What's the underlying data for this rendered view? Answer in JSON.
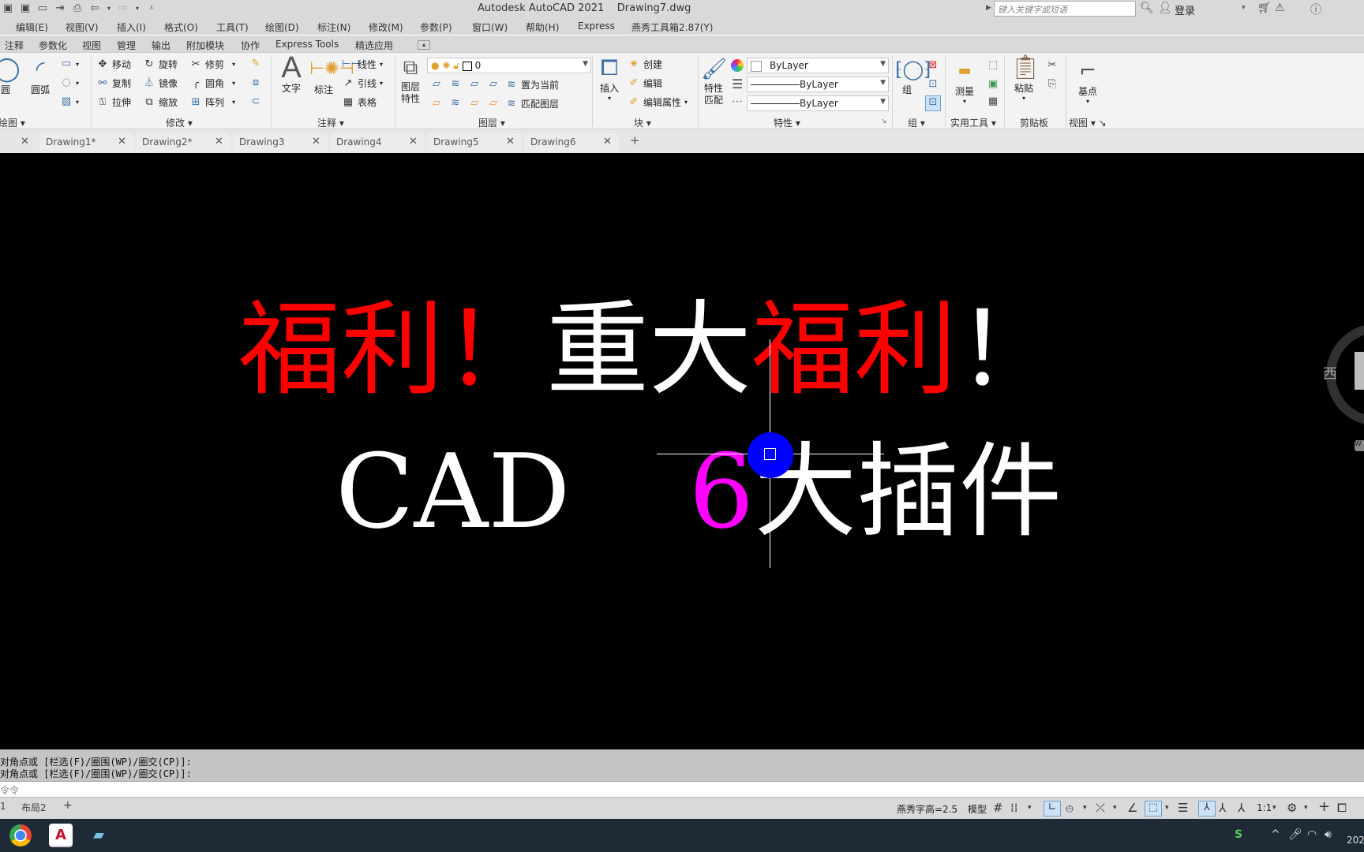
{
  "titlebar": {
    "title": "Autodesk AutoCAD 2021    Drawing7.dwg",
    "quick_access": [
      {
        "name": "save-icon",
        "glyph": "🖫"
      },
      {
        "name": "save-as-icon",
        "glyph": "🖫"
      },
      {
        "name": "open-icon",
        "glyph": "🗋"
      },
      {
        "name": "import-icon",
        "glyph": "⇥"
      },
      {
        "name": "print-icon",
        "glyph": "⎙"
      },
      {
        "name": "undo-icon",
        "glyph": "⇦"
      },
      {
        "name": "redo-icon",
        "glyph": "⇨"
      },
      {
        "name": "customize-icon",
        "glyph": "▾"
      }
    ],
    "search_placeholder": "键入关键字或短语",
    "login_label": "登录"
  },
  "menubar": [
    "编辑(E)",
    "视图(V)",
    "插入(I)",
    "格式(O)",
    "工具(T)",
    "绘图(D)",
    "标注(N)",
    "修改(M)",
    "参数(P)",
    "窗口(W)",
    "帮助(H)",
    "Express",
    "燕秀工具箱2.87(Y)"
  ],
  "ribbon_tabs": [
    "注释",
    "参数化",
    "视图",
    "管理",
    "输出",
    "附加模块",
    "协作",
    "Express Tools",
    "精选应用"
  ],
  "ribbon": {
    "draw": {
      "label": "绘图",
      "circle": "圆",
      "arc": "圆弧"
    },
    "modify": {
      "label": "修改",
      "items": [
        "移动",
        "旋转",
        "修剪",
        "复制",
        "镜像",
        "圆角",
        "拉伸",
        "缩放",
        "阵列"
      ]
    },
    "annotation": {
      "label": "注释",
      "text": "文字",
      "dimension": "标注",
      "linear": "线性",
      "leader": "引线",
      "table": "表格"
    },
    "layers": {
      "label": "图层",
      "properties": "图层特性",
      "current_layer": "0",
      "set_current": "置为当前",
      "match_layer": "匹配图层"
    },
    "block": {
      "label": "块",
      "insert": "插入",
      "create": "创建",
      "edit": "编辑",
      "edit_attr": "编辑属性"
    },
    "properties": {
      "label": "特性",
      "match": "特性匹配",
      "color": "ByLayer",
      "linetype": "ByLayer",
      "lineweight": "ByLayer"
    },
    "groups": {
      "label": "组",
      "group": "组"
    },
    "utilities": {
      "label": "实用工具",
      "measure": "测量"
    },
    "clipboard": {
      "label": "剪贴板",
      "paste": "粘贴"
    },
    "view": {
      "label": "视图",
      "base": "基点"
    }
  },
  "doc_tabs": [
    "Drawing1*",
    "Drawing2*",
    "Drawing3",
    "Drawing4",
    "Drawing5",
    "Drawing6"
  ],
  "canvas": {
    "line1": [
      {
        "text": "福利！",
        "color": "#ff0000"
      },
      {
        "text": "重大",
        "color": "#ffffff"
      },
      {
        "text": "福利",
        "color": "#ff0000"
      },
      {
        "text": "！",
        "color": "#ffffff"
      }
    ],
    "line2": [
      {
        "text": "CAD",
        "color": "#ffffff"
      },
      {
        "text": "6",
        "color": "#ff00ff"
      },
      {
        "text": "大插件",
        "color": "#ffffff"
      }
    ],
    "viewcube_label": "西",
    "wcs_label": "W"
  },
  "command": {
    "history": [
      "对角点或 [栏选(F)/圈围(WP)/圈交(CP)]:",
      "对角点或 [栏选(F)/圈围(WP)/圈交(CP)]:"
    ],
    "placeholder": "令令"
  },
  "layout_tabs": [
    "1",
    "布局2"
  ],
  "statusbar": {
    "text_height": "燕秀字高=2.5",
    "model": "模型",
    "scale": "1:1"
  },
  "taskbar": {
    "apps": [
      "chrome",
      "autocad",
      "notepad"
    ],
    "clock_partial": "202"
  }
}
